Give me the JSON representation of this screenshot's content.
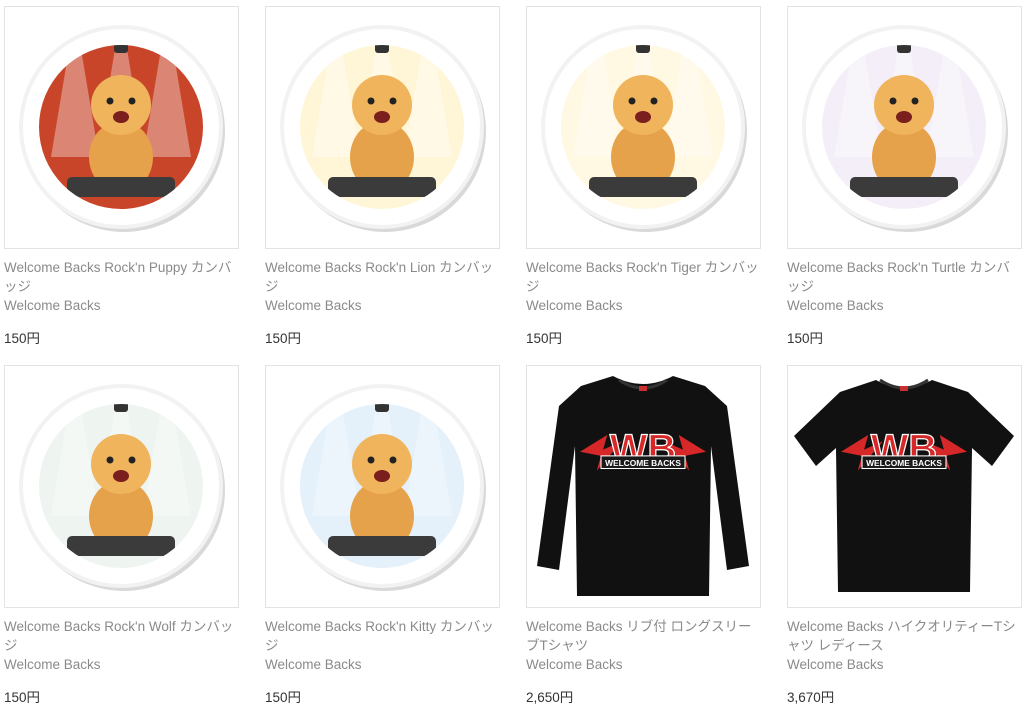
{
  "products": [
    {
      "title": "Welcome Backs Rock'n Puppy カンバッジ",
      "shop": "Welcome Backs",
      "price": "150円",
      "image": "badge-puppy-drummer",
      "kind": "badge",
      "bg": "#c8452a"
    },
    {
      "title": "Welcome Backs Rock'n Lion カンバッジ",
      "shop": "Welcome Backs",
      "price": "150円",
      "image": "badge-lion-bassist",
      "kind": "badge",
      "bg": "#fff6d8"
    },
    {
      "title": "Welcome Backs Rock'n Tiger カンバッジ",
      "shop": "Welcome Backs",
      "price": "150円",
      "image": "badge-tiger-guitarist",
      "kind": "badge",
      "bg": "#fff8e2"
    },
    {
      "title": "Welcome Backs Rock'n Turtle カンバッジ",
      "shop": "Welcome Backs",
      "price": "150円",
      "image": "badge-turtle-singer",
      "kind": "badge",
      "bg": "#f3eef8"
    },
    {
      "title": "Welcome Backs Rock'n Wolf カンバッジ",
      "shop": "Welcome Backs",
      "price": "150円",
      "image": "badge-wolf-singer",
      "kind": "badge",
      "bg": "#eef4f0"
    },
    {
      "title": "Welcome Backs Rock'n Kitty カンバッジ",
      "shop": "Welcome Backs",
      "price": "150円",
      "image": "badge-kitty-keyboard",
      "kind": "badge",
      "bg": "#e4f0fa"
    },
    {
      "title": "Welcome Backs リブ付 ロングスリーブTシャツ",
      "shop": "Welcome Backs",
      "price": "2,650円",
      "image": "longsleeve-tshirt-black",
      "kind": "longsleeve",
      "bg": "#111111"
    },
    {
      "title": "Welcome Backs ハイクオリティーTシャツ レディース",
      "shop": "Welcome Backs",
      "price": "3,670円",
      "image": "tshirt-black-ladies",
      "kind": "tshirt",
      "bg": "#111111"
    }
  ],
  "logo_text": "WELCOME BACKS",
  "logo_initials": "WB",
  "colors": {
    "title_text": "#8a8a8a",
    "price_text": "#333333",
    "card_border": "#e3e3e3",
    "logo_red": "#d62828"
  }
}
